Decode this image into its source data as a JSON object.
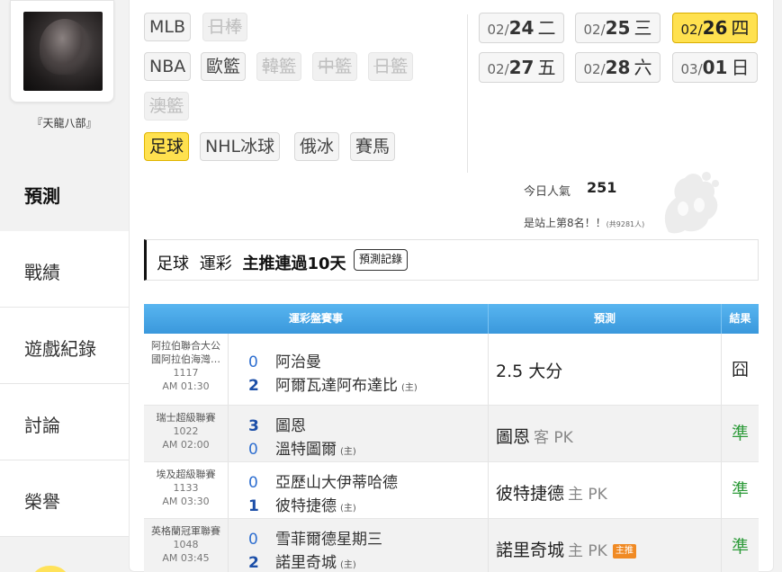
{
  "user": {
    "name": "『天龍八部』"
  },
  "nav": [
    {
      "label": "預測",
      "active": true
    },
    {
      "label": "戰績"
    },
    {
      "label": "遊戲紀錄"
    },
    {
      "label": "討論"
    },
    {
      "label": "榮譽"
    }
  ],
  "sports": {
    "row1": [
      "MLB",
      "日棒"
    ],
    "row2": [
      "NBA",
      "歐籃",
      "韓籃",
      "中籃",
      "日籃"
    ],
    "row3": [
      "澳籃"
    ],
    "row4": [
      "足球",
      "NHL冰球",
      "俄冰",
      "賽馬"
    ]
  },
  "dates": [
    {
      "md": "02/",
      "d": "24",
      "w": "二"
    },
    {
      "md": "02/",
      "d": "25",
      "w": "三"
    },
    {
      "md": "02/",
      "d": "26",
      "w": "四",
      "active": true
    },
    {
      "md": "02/",
      "d": "27",
      "w": "五"
    },
    {
      "md": "02/",
      "d": "28",
      "w": "六"
    },
    {
      "md": "03/",
      "d": "01",
      "w": "日"
    }
  ],
  "popularity": {
    "label": "今日人氣",
    "count": "251",
    "rank_text": "是站上第8名！！",
    "rank_total": "(共9281人)"
  },
  "section": {
    "sport": "足球",
    "type": "運彩",
    "streak": "主推連過10天",
    "history_button": "預測記錄"
  },
  "table": {
    "headers": [
      "運彩盤賽事",
      "預測",
      "結果"
    ],
    "home_marker": "(主)",
    "rows": [
      {
        "league": "阿拉伯聯合大公國阿拉伯海灣…",
        "league_line1": "阿拉伯聯合大公",
        "league_line2": "國阿拉伯海灣…",
        "game_no": "1117",
        "time": "AM 01:30",
        "away": {
          "score": "0",
          "name": "阿治曼"
        },
        "home": {
          "score": "2",
          "name": "阿爾瓦達阿布達比"
        },
        "prediction": "2.5 大分",
        "prediction_sub": "",
        "badge": "",
        "result": "囧",
        "result_color": "#333333"
      },
      {
        "league_line1": "瑞士超級聯賽",
        "game_no": "1022",
        "time": "AM 02:00",
        "away": {
          "score": "3",
          "name": "圖恩"
        },
        "home": {
          "score": "0",
          "name": "溫特圖爾"
        },
        "prediction": "圖恩",
        "prediction_sub": "客 PK",
        "badge": "",
        "result": "準",
        "result_color": "#2e9b3a"
      },
      {
        "league_line1": "埃及超級聯賽",
        "game_no": "1133",
        "time": "AM 03:30",
        "away": {
          "score": "0",
          "name": "亞歷山大伊蒂哈德"
        },
        "home": {
          "score": "1",
          "name": "彼特捷德"
        },
        "prediction": "彼特捷德",
        "prediction_sub": "主 PK",
        "badge": "",
        "result": "準",
        "result_color": "#2e9b3a"
      },
      {
        "league_line1": "英格蘭冠軍聯賽",
        "game_no": "1048",
        "time": "AM 03:45",
        "away": {
          "score": "0",
          "name": "雪菲爾德星期三"
        },
        "home": {
          "score": "2",
          "name": "諾里奇城"
        },
        "prediction": "諾里奇城",
        "prediction_sub": "主 PK",
        "badge": "主推",
        "result": "準",
        "result_color": "#2e9b3a"
      }
    ]
  },
  "colors": {
    "accent": "#ffe14f",
    "header_blue": "#3a98dc",
    "win_green": "#2e9b3a"
  }
}
